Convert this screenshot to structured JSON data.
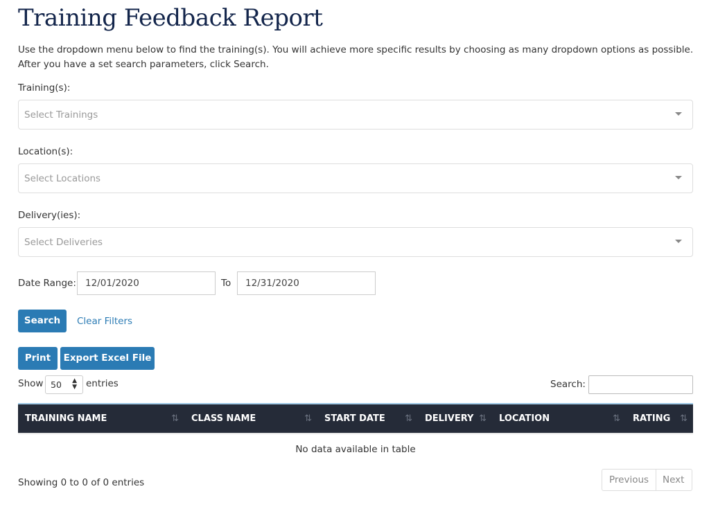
{
  "title": "Training Feedback Report",
  "intro": "Use the dropdown menu below to find the training(s). You will achieve more specific results by choosing as many dropdown options as possible. After you have a set search parameters, click Search.",
  "filters": {
    "trainings": {
      "label": "Training(s):",
      "placeholder": "Select Trainings"
    },
    "locations": {
      "label": "Location(s):",
      "placeholder": "Select Locations"
    },
    "deliveries": {
      "label": "Delivery(ies):",
      "placeholder": "Select Deliveries"
    },
    "date_range_label": "Date Range:",
    "from": "12/01/2020",
    "to_label": "To",
    "to": "12/31/2020"
  },
  "buttons": {
    "search": "Search",
    "clear": "Clear Filters",
    "print": "Print",
    "export": "Export Excel File"
  },
  "table_controls": {
    "show": "Show",
    "entries_value": "50",
    "entries": "entries",
    "search_label": "Search:"
  },
  "table": {
    "columns": [
      "TRAINING NAME",
      "CLASS NAME",
      "START DATE",
      "DELIVERY",
      "LOCATION",
      "RATING"
    ],
    "empty": "No data available in table"
  },
  "footer": {
    "info": "Showing 0 to 0 of 0 entries",
    "previous": "Previous",
    "next": "Next"
  },
  "colors": {
    "accent": "#2b7bb4",
    "header_bg": "#252b38",
    "title": "#13254b"
  }
}
